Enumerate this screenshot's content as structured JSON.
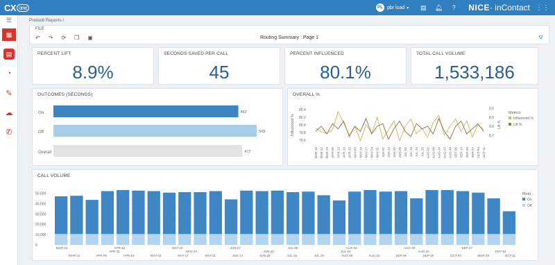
{
  "topbar": {
    "logo_cx": "CX",
    "logo_one": "one",
    "user_initials": "PL",
    "user_name": "pbr load",
    "brand_bold": "NICE",
    "brand_rest": "· inContact",
    "icons": [
      "chat-icon",
      "bell-icon",
      "help-icon",
      "grid-icon"
    ]
  },
  "sidebar": {
    "items": [
      "menu-icon",
      "reports-icon",
      "document-icon",
      "dashboard-gauge-icon",
      "edit-icon",
      "cloud-icon",
      "phone-icon"
    ]
  },
  "breadcrumb": "Prebuilt Reports /",
  "toolbar": {
    "file_label": "FILE",
    "report_title": "Routing Summary : Page 1",
    "icons": [
      "undo-icon",
      "redo-icon",
      "refresh-icon",
      "copy-icon",
      "save-icon",
      "filter-icon"
    ]
  },
  "kpis": [
    {
      "title": "PERCENT LIFT",
      "value": "8.9%"
    },
    {
      "title": "SECONDS SAVED PER CALL",
      "value": "45"
    },
    {
      "title": "PERCENT INFLUENCED",
      "value": "80.1%"
    },
    {
      "title": "TOTAL CALL VOLUME",
      "value": "1,533,186"
    }
  ],
  "outcomes": {
    "title": "OUTCOMES (SECONDS)",
    "rows": [
      {
        "label": "On",
        "value": 462,
        "display": "462",
        "color": "#3b86c2"
      },
      {
        "label": "Off",
        "value": 508,
        "display": "508",
        "color": "#a9cde9"
      },
      {
        "label": "Overall",
        "value": 472,
        "display": "472",
        "color": "#e3e3e3"
      }
    ],
    "max": 520
  },
  "overall": {
    "title": "OVERALL %"
  },
  "call_volume": {
    "title": "CALL VOLUME"
  },
  "chart_data": [
    {
      "type": "line",
      "title": "OVERALL %",
      "ylabel": "Influenced %",
      "y2label": "Lift %",
      "ylim": [
        79.6,
        80.6
      ],
      "y_ticks": [
        "80.4",
        "80.2",
        "80.0",
        "79.8",
        "79.6"
      ],
      "y2lim": [
        8.6,
        9.3
      ],
      "y2_ticks": [
        "9.0",
        "8.9",
        "8.8",
        "8.7"
      ],
      "legend_title": "Metrics",
      "legend_position": "right",
      "categories": [
        "MAR-15",
        "MAR-22",
        "MAR-29",
        "APR-05",
        "APR-12",
        "APR-19",
        "APR-26",
        "MAY-03",
        "MAY-10",
        "MAY-17",
        "MAY-24",
        "MAY-31",
        "JUN-07",
        "JUN-14",
        "JUN-21",
        "JUN-28",
        "JUL-05",
        "JUL-12",
        "JUL-19",
        "JUL-26",
        "AUG-02",
        "AUG-09",
        "AUG-16",
        "AUG-23",
        "AUG-30",
        "SEP-06",
        "SEP-13",
        "SEP-20",
        "SEP-27",
        "OCT-04",
        "OCT-11"
      ],
      "series": [
        {
          "name": "Influenced %",
          "color": "#c9bf6a",
          "values": [
            80.05,
            79.95,
            79.9,
            80.0,
            80.5,
            80.2,
            79.85,
            80.1,
            79.7,
            80.15,
            79.9,
            80.35,
            79.75,
            80.0,
            80.25,
            79.7,
            80.1,
            80.3,
            79.9,
            80.05,
            79.8,
            80.2,
            80.4,
            79.85,
            80.1,
            80.3,
            79.95,
            80.25,
            79.8,
            80.15,
            80.0
          ]
        },
        {
          "name": "Lift %",
          "color": "#9a7a4f",
          "values": [
            8.85,
            8.95,
            8.8,
            9.0,
            8.9,
            9.05,
            8.75,
            8.95,
            8.85,
            9.1,
            8.8,
            8.95,
            9.0,
            8.7,
            8.9,
            9.05,
            8.85,
            8.75,
            9.0,
            8.9,
            8.95,
            8.8,
            9.1,
            8.85,
            8.7,
            8.95,
            9.05,
            8.8,
            8.9,
            9.0,
            8.85
          ]
        }
      ]
    },
    {
      "type": "bar",
      "stacked": true,
      "title": "CALL VOLUME",
      "ylim": [
        0,
        55000
      ],
      "y_ticks": [
        "50,000",
        "40,000",
        "30,000",
        "20,000",
        "10,000",
        "0"
      ],
      "legend_title": "Metri...",
      "legend_position": "right",
      "x_labels_top": [
        "MAR-15",
        "APR-12",
        "MAY-10",
        "JUN-07",
        "JUL-05",
        "AUG-02",
        "AUG-30",
        "SEP-27"
      ],
      "x_labels_mid": [
        "APR-26",
        "MAY-24",
        "JUN-21",
        "JUL-19",
        "AUG-16",
        "SEP-13"
      ],
      "x_labels_bottom": [
        "MAR-22",
        "APR-05",
        "APR-19",
        "MAY-03",
        "MAY-17",
        "MAY-31",
        "JUN-14",
        "JUN-28",
        "JUL-12",
        "JUL-26",
        "AUG-09",
        "AUG-23",
        "SEP-06",
        "SEP-20",
        "OCT-04",
        "MAR-29",
        "OCT-11"
      ],
      "series": [
        {
          "name": "On",
          "color": "#3f86c4",
          "values": [
            36500,
            37000,
            33000,
            41500,
            42500,
            42000,
            41500,
            40000,
            40500,
            40500,
            41500,
            33500,
            42000,
            41500,
            42000,
            40500,
            41000,
            37500,
            32500,
            41000,
            42500,
            41000,
            41500,
            34500,
            42500,
            42500,
            41500,
            40000,
            34500,
            22000
          ]
        },
        {
          "name": "Off",
          "color": "#b3d4ee",
          "values": [
            10500,
            10500,
            10500,
            10500,
            10500,
            10500,
            10500,
            10500,
            10500,
            10500,
            10500,
            10500,
            10500,
            10500,
            10500,
            10500,
            10500,
            10500,
            10500,
            10500,
            10500,
            10500,
            10500,
            10500,
            10500,
            10500,
            10500,
            10500,
            10500,
            10500
          ]
        }
      ]
    }
  ]
}
